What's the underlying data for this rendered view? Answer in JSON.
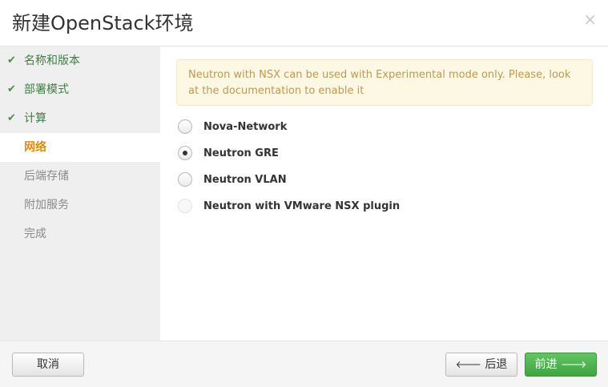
{
  "dialog": {
    "title": "新建OpenStack环境",
    "close_symbol": "×"
  },
  "sidebar": {
    "steps": [
      {
        "label": "名称和版本",
        "state": "done"
      },
      {
        "label": "部署模式",
        "state": "done"
      },
      {
        "label": "计算",
        "state": "done"
      },
      {
        "label": "网络",
        "state": "active"
      },
      {
        "label": "后端存储",
        "state": "todo"
      },
      {
        "label": "附加服务",
        "state": "todo"
      },
      {
        "label": "完成",
        "state": "todo"
      }
    ]
  },
  "content": {
    "alert_text": "Neutron with NSX can be used with Experimental mode only. Please, look at the documentation to enable it",
    "options": [
      {
        "label": "Nova-Network",
        "selected": false,
        "disabled": false
      },
      {
        "label": "Neutron GRE",
        "selected": true,
        "disabled": false
      },
      {
        "label": "Neutron VLAN",
        "selected": false,
        "disabled": false
      },
      {
        "label": "Neutron with VMware NSX plugin",
        "selected": false,
        "disabled": true
      }
    ]
  },
  "footer": {
    "cancel_label": "取消",
    "back_label": "后退",
    "next_label": "前进"
  },
  "colors": {
    "done_step": "#3d7f43",
    "active_step": "#e08a0f",
    "primary_button": "#52b352",
    "alert_bg": "#fcf8e3"
  },
  "icons": {
    "check": "check-icon",
    "back": "arrow-left-icon",
    "next": "arrow-right-icon",
    "close": "close-icon"
  }
}
